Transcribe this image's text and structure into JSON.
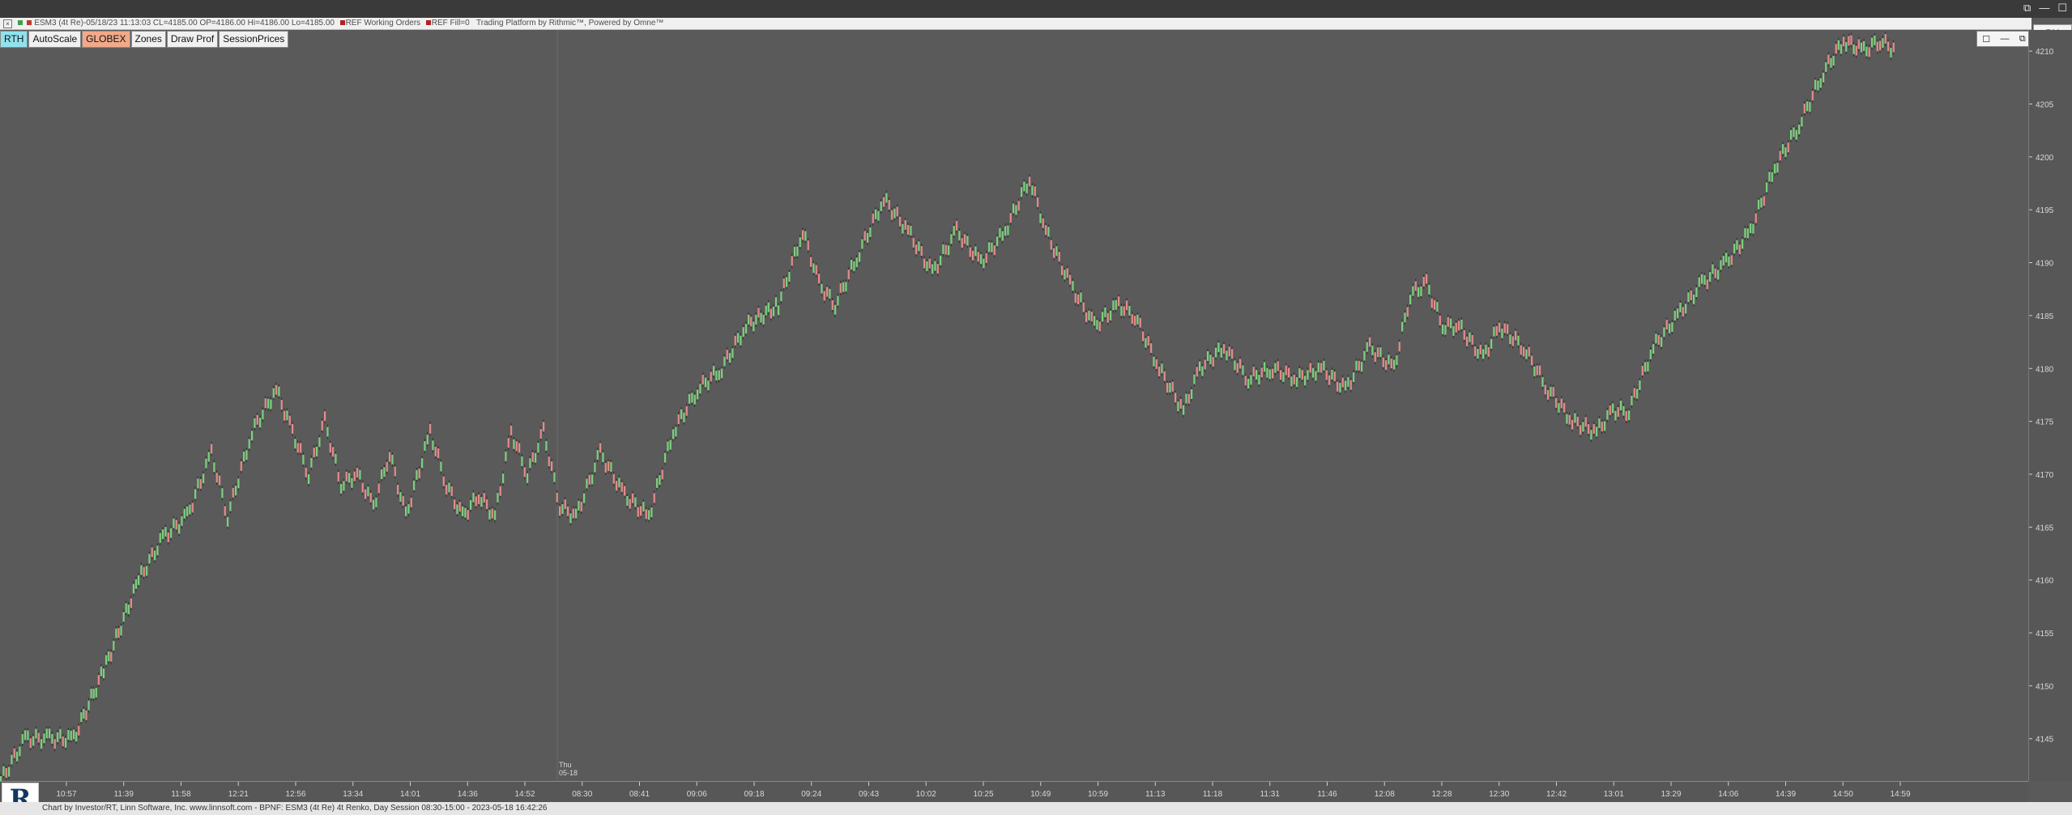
{
  "window": {
    "controls": [
      "⧉",
      "—",
      "☐"
    ]
  },
  "titlebar": {
    "text": "ESM3 (4t Re)-05/18/23 11:13:03 CL=4185.00 OP=4186.00 Hi=4186.00 Lo=4185.00",
    "working_orders": "REF Working Orders",
    "fill": "REF Fill=0",
    "platform": "Trading Platform by Rithmic™, Powered by Omne™"
  },
  "rm_label": "RM",
  "toolbar": {
    "buttons": [
      "RTH",
      "AutoScale",
      "GLOBEX",
      "Zones",
      "Draw Prof",
      "SessionPrices"
    ]
  },
  "panel_controls": [
    "☐",
    "—",
    "⧉"
  ],
  "footer": {
    "text": "Chart by Investor/RT, Linn Software, Inc. www.linnsoft.com - BPNF: ESM3 (4t Re) 4t Renko, Day Session 08:30-15:00 - 2023-05-18 16:42:26"
  },
  "day_marker": {
    "line1": "Thu",
    "line2": "05-18"
  },
  "colors": {
    "background": "#5a5a5a",
    "up_bar": "#7dd07d",
    "down_bar": "#e58a8a",
    "axis_text": "#d8d8d8"
  },
  "chart_data": {
    "type": "line",
    "title": "ESM3 (4t Re) 4t Renko",
    "ylim": [
      4141,
      4212
    ],
    "y_ticks": [
      4145,
      4150,
      4155,
      4160,
      4165,
      4170,
      4175,
      4180,
      4185,
      4190,
      4195,
      4200,
      4205,
      4210
    ],
    "x_tick_labels": [
      "10:57",
      "11:39",
      "11:58",
      "12:21",
      "12:56",
      "13:34",
      "14:01",
      "14:36",
      "14:52",
      "08:30",
      "08:41",
      "09:06",
      "09:18",
      "09:24",
      "09:43",
      "10:02",
      "10:25",
      "10:49",
      "10:59",
      "11:13",
      "11:18",
      "11:31",
      "11:46",
      "12:08",
      "12:28",
      "12:30",
      "12:42",
      "13:01",
      "13:29",
      "14:06",
      "14:39",
      "14:50",
      "14:59"
    ],
    "series": [
      {
        "name": "ESM3 Renko",
        "description_points": [
          [
            0,
            4141
          ],
          [
            30,
            4145
          ],
          [
            60,
            4145
          ],
          [
            90,
            4145
          ],
          [
            130,
            4152
          ],
          [
            170,
            4160
          ],
          [
            200,
            4164
          ],
          [
            230,
            4166
          ],
          [
            260,
            4172
          ],
          [
            280,
            4166
          ],
          [
            310,
            4174
          ],
          [
            340,
            4178
          ],
          [
            360,
            4174
          ],
          [
            380,
            4170
          ],
          [
            400,
            4175
          ],
          [
            420,
            4169
          ],
          [
            440,
            4170
          ],
          [
            460,
            4167
          ],
          [
            480,
            4172
          ],
          [
            500,
            4166
          ],
          [
            530,
            4174
          ],
          [
            550,
            4169
          ],
          [
            570,
            4166
          ],
          [
            590,
            4168
          ],
          [
            610,
            4166
          ],
          [
            630,
            4174
          ],
          [
            650,
            4170
          ],
          [
            670,
            4174
          ],
          [
            690,
            4167
          ],
          [
            710,
            4166
          ],
          [
            740,
            4172
          ],
          [
            770,
            4168
          ],
          [
            800,
            4166
          ],
          [
            830,
            4174
          ],
          [
            860,
            4178
          ],
          [
            890,
            4180
          ],
          [
            920,
            4184
          ],
          [
            960,
            4186
          ],
          [
            990,
            4193
          ],
          [
            1010,
            4188
          ],
          [
            1030,
            4186
          ],
          [
            1060,
            4191
          ],
          [
            1090,
            4196
          ],
          [
            1120,
            4193
          ],
          [
            1150,
            4189
          ],
          [
            1180,
            4193
          ],
          [
            1210,
            4190
          ],
          [
            1240,
            4193
          ],
          [
            1270,
            4198
          ],
          [
            1290,
            4193
          ],
          [
            1320,
            4188
          ],
          [
            1350,
            4184
          ],
          [
            1380,
            4186
          ],
          [
            1400,
            4185
          ],
          [
            1430,
            4180
          ],
          [
            1460,
            4176
          ],
          [
            1480,
            4180
          ],
          [
            1510,
            4182
          ],
          [
            1540,
            4179
          ],
          [
            1570,
            4180
          ],
          [
            1600,
            4179
          ],
          [
            1630,
            4180
          ],
          [
            1660,
            4178
          ],
          [
            1690,
            4182
          ],
          [
            1720,
            4180
          ],
          [
            1740,
            4187
          ],
          [
            1760,
            4188
          ],
          [
            1780,
            4184
          ],
          [
            1800,
            4184
          ],
          [
            1830,
            4181
          ],
          [
            1850,
            4184
          ],
          [
            1880,
            4182
          ],
          [
            1910,
            4178
          ],
          [
            1940,
            4175
          ],
          [
            1970,
            4174
          ],
          [
            1990,
            4176
          ],
          [
            2010,
            4176
          ],
          [
            2040,
            4182
          ],
          [
            2070,
            4185
          ],
          [
            2100,
            4188
          ],
          [
            2130,
            4190
          ],
          [
            2160,
            4193
          ],
          [
            2190,
            4199
          ],
          [
            2220,
            4203
          ],
          [
            2250,
            4208
          ],
          [
            2275,
            4211
          ],
          [
            2300,
            4210
          ],
          [
            2320,
            4211
          ],
          [
            2340,
            4210
          ]
        ]
      }
    ],
    "xlabel": "",
    "ylabel": ""
  }
}
